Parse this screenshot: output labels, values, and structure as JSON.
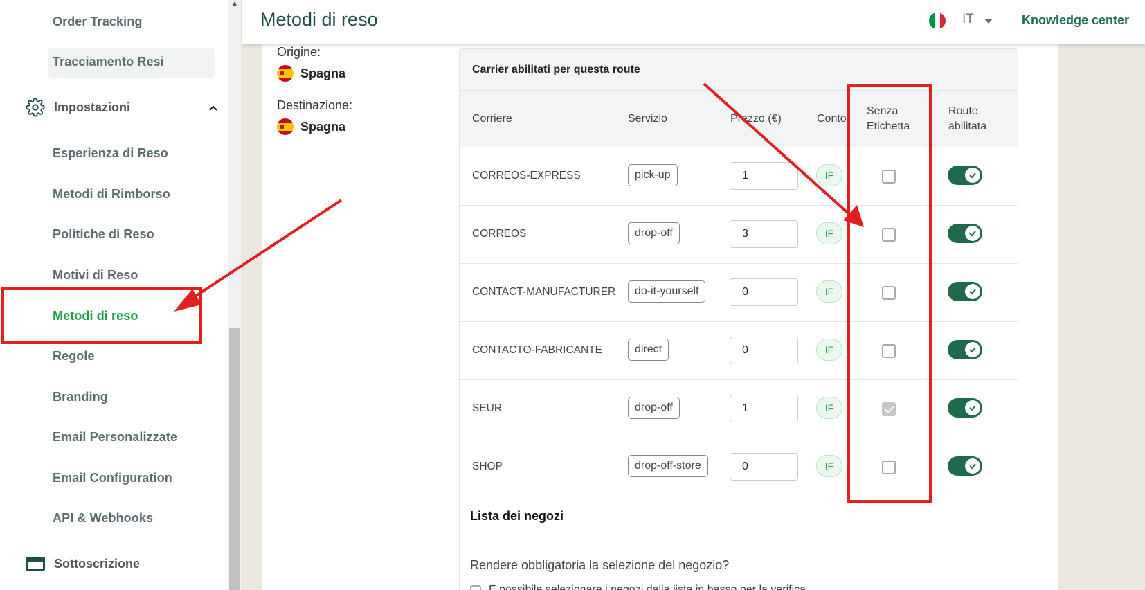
{
  "sidebar": {
    "items": [
      {
        "label": "Order Tracking"
      },
      {
        "label": "Tracciamento Resi"
      }
    ],
    "section_settings": "Impostazioni",
    "settings_items": [
      {
        "label": "Esperienza di Reso"
      },
      {
        "label": "Metodi di Rimborso"
      },
      {
        "label": "Politiche di Reso"
      },
      {
        "label": "Motivi di Reso"
      },
      {
        "label": "Metodi di reso"
      },
      {
        "label": "Regole"
      },
      {
        "label": "Branding"
      },
      {
        "label": "Email Personalizzate"
      },
      {
        "label": "Email Configuration"
      },
      {
        "label": "API & Webhooks"
      }
    ],
    "section_subscription": "Sottoscrizione"
  },
  "header": {
    "title": "Metodi di reso",
    "language": "IT",
    "knowledge_center": "Knowledge center"
  },
  "route": {
    "origin_label": "Origine:",
    "origin_country": "Spagna",
    "destination_label": "Destinazione:",
    "destination_country": "Spagna"
  },
  "carriers_card": {
    "title": "Carrier abilitati per questa route",
    "columns": {
      "carrier": "Corriere",
      "service": "Servizio",
      "price": "Prezzo (€)",
      "account": "Conto",
      "no_label_1": "Senza",
      "no_label_2": "Etichetta",
      "route_enabled_1": "Route",
      "route_enabled_2": "abilitata"
    },
    "rows": [
      {
        "carrier": "CORREOS-EXPRESS",
        "service": "pick-up",
        "price": "1",
        "account": "IF",
        "no_label": false,
        "enabled": true
      },
      {
        "carrier": "CORREOS",
        "service": "drop-off",
        "price": "3",
        "account": "IF",
        "no_label": false,
        "enabled": true
      },
      {
        "carrier": "CONTACT-MANUFACTURER",
        "service": "do-it-yourself",
        "price": "0",
        "account": "IF",
        "no_label": false,
        "enabled": true
      },
      {
        "carrier": "CONTACTO-FABRICANTE",
        "service": "direct",
        "price": "0",
        "account": "IF",
        "no_label": false,
        "enabled": true
      },
      {
        "carrier": "SEUR",
        "service": "drop-off",
        "price": "1",
        "account": "IF",
        "no_label": true,
        "enabled": true
      },
      {
        "carrier": "SHOP",
        "service": "drop-off-store",
        "price": "0",
        "account": "IF",
        "no_label": false,
        "enabled": true
      }
    ]
  },
  "stores": {
    "title": "Lista dei negozi",
    "question": "Rendere obbligatoria la selezione del negozio?",
    "partial_text": "È possibile selezionare i negozi dalla lista in basso per la verifica"
  },
  "colors": {
    "brand": "#1e6b4c",
    "active_nav": "#1f9e4a",
    "annotation": "#e0211f"
  }
}
